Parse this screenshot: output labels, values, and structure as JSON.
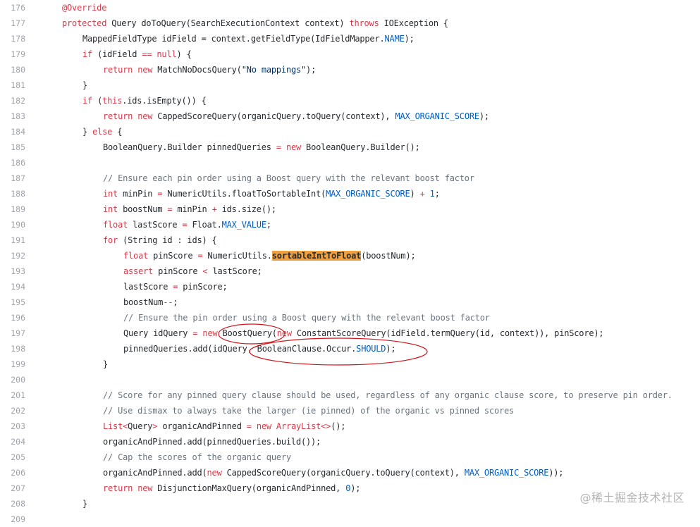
{
  "colors": {
    "keyword": "#d73a49",
    "comment": "#6a737d",
    "constant": "#005cc5",
    "string": "#032f62",
    "highlight": "#f2a03c",
    "annotation_circle": "#d0141c"
  },
  "code_lines": [
    {
      "num": "176",
      "indent": 0,
      "tokens": [
        {
          "t": "an",
          "v": "@Override"
        }
      ]
    },
    {
      "num": "177",
      "indent": 0,
      "tokens": [
        {
          "t": "kw",
          "v": "protected"
        },
        {
          "t": "p",
          "v": " Query doToQuery(SearchExecutionContext context) "
        },
        {
          "t": "kw",
          "v": "throws"
        },
        {
          "t": "p",
          "v": " IOException {"
        }
      ]
    },
    {
      "num": "178",
      "indent": 1,
      "tokens": [
        {
          "t": "p",
          "v": "MappedFieldType idField = context.getFieldType(IdFieldMapper."
        },
        {
          "t": "cn",
          "v": "NAME"
        },
        {
          "t": "p",
          "v": ");"
        }
      ]
    },
    {
      "num": "179",
      "indent": 1,
      "tokens": [
        {
          "t": "kw",
          "v": "if"
        },
        {
          "t": "p",
          "v": " (idField "
        },
        {
          "t": "op",
          "v": "=="
        },
        {
          "t": "p",
          "v": " "
        },
        {
          "t": "kw",
          "v": "null"
        },
        {
          "t": "p",
          "v": ") {"
        }
      ]
    },
    {
      "num": "180",
      "indent": 2,
      "tokens": [
        {
          "t": "kw",
          "v": "return"
        },
        {
          "t": "p",
          "v": " "
        },
        {
          "t": "kw",
          "v": "new"
        },
        {
          "t": "p",
          "v": " MatchNoDocsQuery("
        },
        {
          "t": "st",
          "v": "\"No mappings\""
        },
        {
          "t": "p",
          "v": ");"
        }
      ]
    },
    {
      "num": "181",
      "indent": 1,
      "tokens": [
        {
          "t": "p",
          "v": "}"
        }
      ]
    },
    {
      "num": "182",
      "indent": 1,
      "tokens": [
        {
          "t": "kw",
          "v": "if"
        },
        {
          "t": "p",
          "v": " ("
        },
        {
          "t": "kw",
          "v": "this"
        },
        {
          "t": "p",
          "v": ".ids.isEmpty()) {"
        }
      ]
    },
    {
      "num": "183",
      "indent": 2,
      "tokens": [
        {
          "t": "kw",
          "v": "return"
        },
        {
          "t": "p",
          "v": " "
        },
        {
          "t": "kw",
          "v": "new"
        },
        {
          "t": "p",
          "v": " CappedScoreQuery(organicQuery.toQuery(context), "
        },
        {
          "t": "cn",
          "v": "MAX_ORGANIC_SCORE"
        },
        {
          "t": "p",
          "v": ");"
        }
      ]
    },
    {
      "num": "184",
      "indent": 1,
      "tokens": [
        {
          "t": "p",
          "v": "} "
        },
        {
          "t": "kw",
          "v": "else"
        },
        {
          "t": "p",
          "v": " {"
        }
      ]
    },
    {
      "num": "185",
      "indent": 2,
      "tokens": [
        {
          "t": "p",
          "v": "BooleanQuery.Builder pinnedQueries "
        },
        {
          "t": "op",
          "v": "="
        },
        {
          "t": "p",
          "v": " "
        },
        {
          "t": "kw",
          "v": "new"
        },
        {
          "t": "p",
          "v": " BooleanQuery.Builder();"
        }
      ]
    },
    {
      "num": "186",
      "indent": 0,
      "tokens": []
    },
    {
      "num": "187",
      "indent": 2,
      "tokens": [
        {
          "t": "co",
          "v": "// Ensure each pin order using a Boost query with the relevant boost factor"
        }
      ]
    },
    {
      "num": "188",
      "indent": 2,
      "tokens": [
        {
          "t": "kw",
          "v": "int"
        },
        {
          "t": "p",
          "v": " minPin "
        },
        {
          "t": "op",
          "v": "="
        },
        {
          "t": "p",
          "v": " NumericUtils.floatToSortableInt("
        },
        {
          "t": "cn",
          "v": "MAX_ORGANIC_SCORE"
        },
        {
          "t": "p",
          "v": ") "
        },
        {
          "t": "op",
          "v": "+"
        },
        {
          "t": "p",
          "v": " "
        },
        {
          "t": "nu",
          "v": "1"
        },
        {
          "t": "p",
          "v": ";"
        }
      ]
    },
    {
      "num": "189",
      "indent": 2,
      "tokens": [
        {
          "t": "kw",
          "v": "int"
        },
        {
          "t": "p",
          "v": " boostNum "
        },
        {
          "t": "op",
          "v": "="
        },
        {
          "t": "p",
          "v": " minPin "
        },
        {
          "t": "op",
          "v": "+"
        },
        {
          "t": "p",
          "v": " ids.size();"
        }
      ]
    },
    {
      "num": "190",
      "indent": 2,
      "tokens": [
        {
          "t": "kw",
          "v": "float"
        },
        {
          "t": "p",
          "v": " lastScore "
        },
        {
          "t": "op",
          "v": "="
        },
        {
          "t": "p",
          "v": " Float."
        },
        {
          "t": "cn",
          "v": "MAX_VALUE"
        },
        {
          "t": "p",
          "v": ";"
        }
      ]
    },
    {
      "num": "191",
      "indent": 2,
      "tokens": [
        {
          "t": "kw",
          "v": "for"
        },
        {
          "t": "p",
          "v": " (String id : ids) {"
        }
      ]
    },
    {
      "num": "192",
      "indent": 3,
      "tokens": [
        {
          "t": "kw",
          "v": "float"
        },
        {
          "t": "p",
          "v": " pinScore "
        },
        {
          "t": "op",
          "v": "="
        },
        {
          "t": "p",
          "v": " NumericUtils."
        },
        {
          "t": "hl",
          "v": "sortableIntToFloat"
        },
        {
          "t": "p",
          "v": "(boostNum);"
        }
      ]
    },
    {
      "num": "193",
      "indent": 3,
      "tokens": [
        {
          "t": "kw",
          "v": "assert"
        },
        {
          "t": "p",
          "v": " pinScore "
        },
        {
          "t": "op",
          "v": "<"
        },
        {
          "t": "p",
          "v": " lastScore;"
        }
      ]
    },
    {
      "num": "194",
      "indent": 3,
      "tokens": [
        {
          "t": "p",
          "v": "lastScore "
        },
        {
          "t": "op",
          "v": "="
        },
        {
          "t": "p",
          "v": " pinScore;"
        }
      ]
    },
    {
      "num": "195",
      "indent": 3,
      "tokens": [
        {
          "t": "p",
          "v": "boostNum"
        },
        {
          "t": "op",
          "v": "--"
        },
        {
          "t": "p",
          "v": ";"
        }
      ]
    },
    {
      "num": "196",
      "indent": 3,
      "tokens": [
        {
          "t": "co",
          "v": "// Ensure the pin order using a Boost query with the relevant boost factor"
        }
      ]
    },
    {
      "num": "197",
      "indent": 3,
      "tokens": [
        {
          "t": "p",
          "v": "Query idQuery "
        },
        {
          "t": "op",
          "v": "="
        },
        {
          "t": "p",
          "v": " "
        },
        {
          "t": "kw",
          "v": "new"
        },
        {
          "t": "p",
          "v": " BoostQuery("
        },
        {
          "t": "kw",
          "v": "new"
        },
        {
          "t": "p",
          "v": " ConstantScoreQuery(idField.termQuery(id, context)), pinScore);"
        }
      ]
    },
    {
      "num": "198",
      "indent": 3,
      "tokens": [
        {
          "t": "p",
          "v": "pinnedQueries.add(idQuery, BooleanClause.Occur."
        },
        {
          "t": "cn",
          "v": "SHOULD"
        },
        {
          "t": "p",
          "v": ");"
        }
      ]
    },
    {
      "num": "199",
      "indent": 2,
      "tokens": [
        {
          "t": "p",
          "v": "}"
        }
      ]
    },
    {
      "num": "200",
      "indent": 0,
      "tokens": []
    },
    {
      "num": "201",
      "indent": 2,
      "tokens": [
        {
          "t": "co",
          "v": "// Score for any pinned query clause should be used, regardless of any organic clause score, to preserve pin order."
        }
      ]
    },
    {
      "num": "202",
      "indent": 2,
      "tokens": [
        {
          "t": "co",
          "v": "// Use dismax to always take the larger (ie pinned) of the organic vs pinned scores"
        }
      ]
    },
    {
      "num": "203",
      "indent": 2,
      "tokens": [
        {
          "t": "kw",
          "v": "List"
        },
        {
          "t": "op",
          "v": "<"
        },
        {
          "t": "p",
          "v": "Query"
        },
        {
          "t": "op",
          "v": ">"
        },
        {
          "t": "p",
          "v": " organicAndPinned "
        },
        {
          "t": "op",
          "v": "="
        },
        {
          "t": "p",
          "v": " "
        },
        {
          "t": "kw",
          "v": "new"
        },
        {
          "t": "p",
          "v": " "
        },
        {
          "t": "kw",
          "v": "ArrayList"
        },
        {
          "t": "op",
          "v": "<>"
        },
        {
          "t": "p",
          "v": "();"
        }
      ]
    },
    {
      "num": "204",
      "indent": 2,
      "tokens": [
        {
          "t": "p",
          "v": "organicAndPinned.add(pinnedQueries.build());"
        }
      ]
    },
    {
      "num": "205",
      "indent": 2,
      "tokens": [
        {
          "t": "co",
          "v": "// Cap the scores of the organic query"
        }
      ]
    },
    {
      "num": "206",
      "indent": 2,
      "tokens": [
        {
          "t": "p",
          "v": "organicAndPinned.add("
        },
        {
          "t": "kw",
          "v": "new"
        },
        {
          "t": "p",
          "v": " CappedScoreQuery(organicQuery.toQuery(context), "
        },
        {
          "t": "cn",
          "v": "MAX_ORGANIC_SCORE"
        },
        {
          "t": "p",
          "v": "));"
        }
      ]
    },
    {
      "num": "207",
      "indent": 2,
      "tokens": [
        {
          "t": "kw",
          "v": "return"
        },
        {
          "t": "p",
          "v": " "
        },
        {
          "t": "kw",
          "v": "new"
        },
        {
          "t": "p",
          "v": " DisjunctionMaxQuery(organicAndPinned, "
        },
        {
          "t": "nu",
          "v": "0"
        },
        {
          "t": "p",
          "v": ");"
        }
      ]
    },
    {
      "num": "208",
      "indent": 1,
      "tokens": [
        {
          "t": "p",
          "v": "}"
        }
      ]
    },
    {
      "num": "209",
      "indent": 0,
      "tokens": []
    }
  ],
  "annotations": [
    {
      "label": "BoostQuery circled"
    },
    {
      "label": "BooleanClause.Occur.SHOULD circled"
    }
  ],
  "watermark": "@稀土掘金技术社区"
}
